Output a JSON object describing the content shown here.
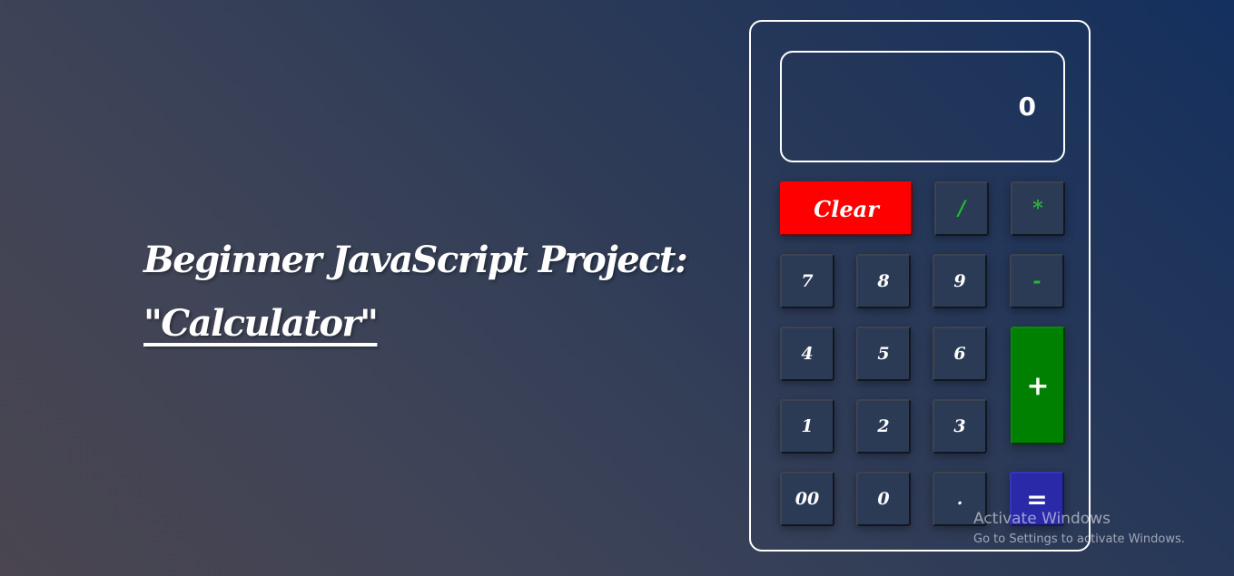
{
  "headline": {
    "title": "Beginner JavaScript Project:",
    "subtitle": "\"Calculator\""
  },
  "calculator": {
    "display_value": "0",
    "keys": {
      "clear": "Clear",
      "divide": "/",
      "multiply": "*",
      "seven": "7",
      "eight": "8",
      "nine": "9",
      "minus": "-",
      "four": "4",
      "five": "5",
      "six": "6",
      "plus": "+",
      "one": "1",
      "two": "2",
      "three": "3",
      "double_zero": "00",
      "zero": "0",
      "decimal": ".",
      "equals": "="
    },
    "colors": {
      "clear": "#ff0000",
      "plus": "#008000",
      "equals": "#2a2aa8",
      "operator_text": "#22bb33",
      "key_background": "#2b3a55"
    }
  },
  "watermark": {
    "title": "Activate Windows",
    "subtitle": "Go to Settings to activate Windows."
  }
}
